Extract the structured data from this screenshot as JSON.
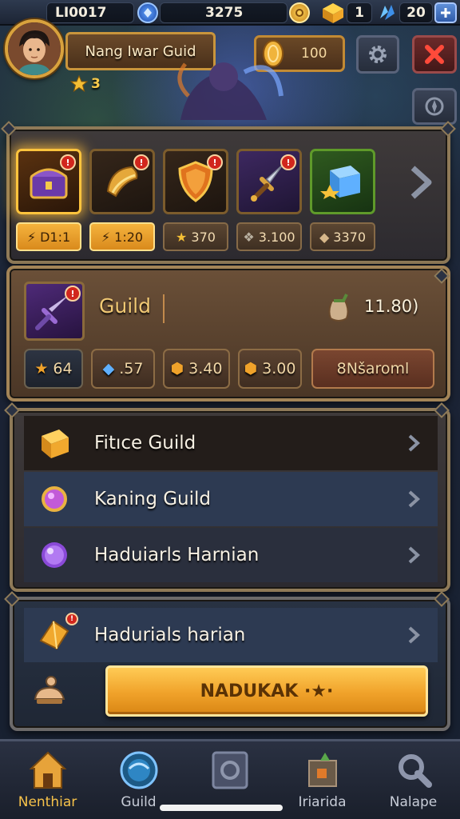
{
  "topbar": {
    "id_text": "LI0017",
    "currency_1": "3275",
    "currency_2": "1",
    "currency_3": "20"
  },
  "player": {
    "name": "Nang Iwar Guid",
    "level": "3",
    "coins": "100"
  },
  "items": [
    {
      "name": "purple-chest",
      "badge": "!",
      "stat": "D1:1",
      "selected": true
    },
    {
      "name": "golden-scroll",
      "badge": "!",
      "stat": "1:20",
      "selected": false
    },
    {
      "name": "golden-shield",
      "badge": "!",
      "stat": "370",
      "selected": false
    },
    {
      "name": "ornate-dagger",
      "badge": "!",
      "stat": "3.100",
      "selected": false
    },
    {
      "name": "blue-crystal-box",
      "badge": "",
      "stat": "3370",
      "selected": false
    }
  ],
  "guild_panel": {
    "title": "Guild",
    "resource_value": "11.80)",
    "chips": [
      "64",
      ".57",
      "3.40",
      "3.00"
    ],
    "action_label": "8Nšaroml"
  },
  "list": [
    {
      "label": "Fitıce Guild",
      "icon": "gold-block-icon",
      "active": true
    },
    {
      "label": "Kaning Guild",
      "icon": "pink-gem-icon",
      "active": false
    },
    {
      "label": "Haduiarls Harnian",
      "icon": "purple-orb-icon",
      "active": false
    }
  ],
  "bottom_panel": {
    "row_label": "Hadurials harian",
    "button_label": "NADUKAK ·★·"
  },
  "nav": [
    {
      "label": "Nenthiar",
      "icon": "home-icon",
      "active": true
    },
    {
      "label": "Guild",
      "icon": "globe-icon",
      "active": false
    },
    {
      "label": "",
      "icon": "shield-icon",
      "active": false
    },
    {
      "label": "Iriarida",
      "icon": "map-icon",
      "active": false
    },
    {
      "label": "Nalape",
      "icon": "settings-icon",
      "active": false
    }
  ],
  "colors": {
    "accent_gold": "#f0a22a",
    "panel_border": "#8f7a58",
    "badge_red": "#d1261d"
  }
}
